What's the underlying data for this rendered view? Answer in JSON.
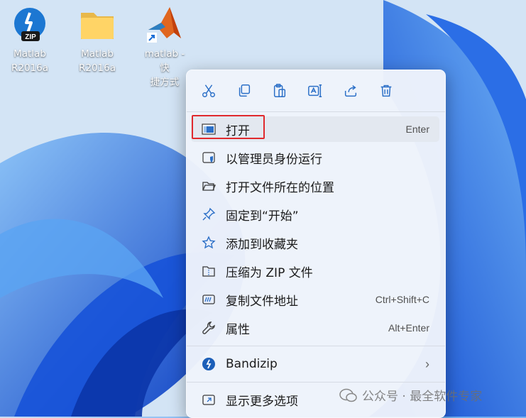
{
  "desktop": {
    "icons": [
      {
        "label_line1": "Matlab",
        "label_line2": "R2016a",
        "icon": "bandizip-zip-icon"
      },
      {
        "label_line1": "Matlab",
        "label_line2": "R2016a",
        "icon": "folder-icon"
      },
      {
        "label_line1": "matlab - 快",
        "label_line2": "捷方式",
        "icon": "matlab-shortcut-icon"
      }
    ]
  },
  "context_menu": {
    "toolbar": [
      "cut-icon",
      "copy-icon",
      "paste-icon",
      "rename-icon",
      "share-icon",
      "delete-icon"
    ],
    "items": [
      {
        "label": "打开",
        "shortcut": "Enter",
        "icon": "window-icon"
      },
      {
        "label": "以管理员身份运行",
        "shortcut": "",
        "icon": "shield-icon"
      },
      {
        "label": "打开文件所在的位置",
        "shortcut": "",
        "icon": "folder-open-icon"
      },
      {
        "label": "固定到“开始”",
        "shortcut": "",
        "icon": "pin-icon"
      },
      {
        "label": "添加到收藏夹",
        "shortcut": "",
        "icon": "star-icon"
      },
      {
        "label": "压缩为 ZIP 文件",
        "shortcut": "",
        "icon": "zip-icon"
      },
      {
        "label": "复制文件地址",
        "shortcut": "Ctrl+Shift+C",
        "icon": "copy-path-icon"
      },
      {
        "label": "属性",
        "shortcut": "Alt+Enter",
        "icon": "wrench-icon"
      },
      {
        "label": "Bandizip",
        "shortcut": "",
        "icon": "bandizip-icon"
      },
      {
        "label": "显示更多选项",
        "shortcut": "",
        "icon": "more-options-icon"
      }
    ]
  },
  "watermark": {
    "text": "公众号 · 最全软件专家"
  },
  "colors": {
    "highlight_border": "#e0292d",
    "accent": "#2f7bd8"
  }
}
